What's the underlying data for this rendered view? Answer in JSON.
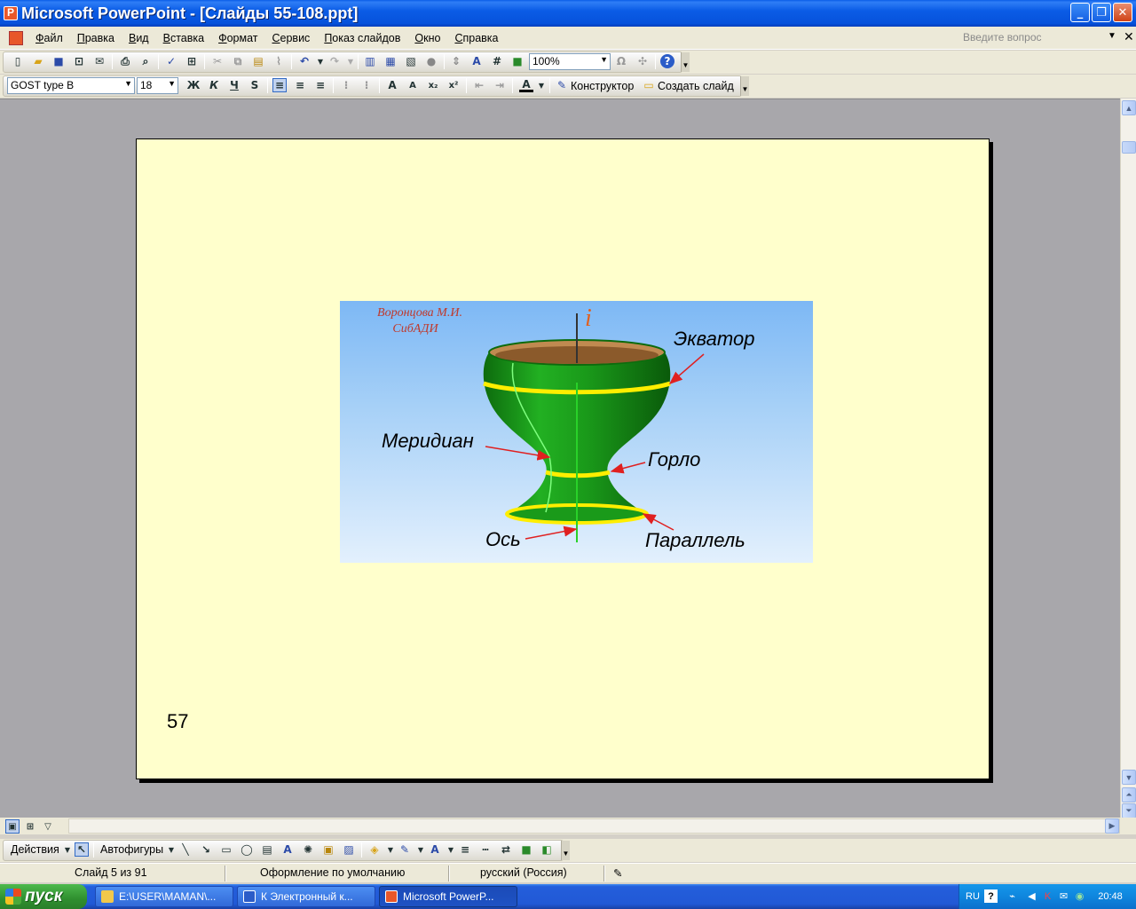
{
  "window": {
    "title": "Microsoft PowerPoint - [Слайды 55-108.ppt]",
    "buttons": [
      "minimize",
      "maximize",
      "close"
    ]
  },
  "menu": {
    "items": [
      "Файл",
      "Правка",
      "Вид",
      "Вставка",
      "Формат",
      "Сервис",
      "Показ слайдов",
      "Окно",
      "Справка"
    ],
    "question_placeholder": "Введите вопрос"
  },
  "toolbar_standard": {
    "zoom": "100%"
  },
  "toolbar_format": {
    "font_name": "GOST type B",
    "font_size": "18",
    "bold": "Ж",
    "italic": "К",
    "underline": "Ч",
    "shadow": "S",
    "designer_label": "Конструктор",
    "new_slide_label": "Создать слайд"
  },
  "slide": {
    "number": "57",
    "picture": {
      "credit_line1": "Воронцова М.И.",
      "credit_line2": "СибАДИ",
      "axis_letter": "i",
      "labels": {
        "equator": "Экватор",
        "meridian": "Меридиан",
        "throat": "Горло",
        "axis": "Ось",
        "parallel": "Параллель"
      }
    }
  },
  "drawing_toolbar": {
    "actions_label": "Действия",
    "autoshapes_label": "Автофигуры"
  },
  "status": {
    "slide_counter": "Слайд 5 из 91",
    "design": "Оформление по умолчанию",
    "language": "русский (Россия)"
  },
  "taskbar": {
    "start_label": "пуск",
    "tasks": [
      {
        "label": "E:\\USER\\MAMAN\\..."
      },
      {
        "label": "К Электронный к..."
      },
      {
        "label": "Microsoft PowerP..."
      }
    ],
    "tray": {
      "language": "RU",
      "clock": "20:48"
    }
  },
  "colors": {
    "titlebar": "#0a5de8",
    "slide_background": "#ffffcc",
    "vase_green": "#1a9a1a",
    "highlight_yellow": "#ffee00",
    "arrow_red": "#e02020",
    "credit_red": "#c0392b"
  }
}
